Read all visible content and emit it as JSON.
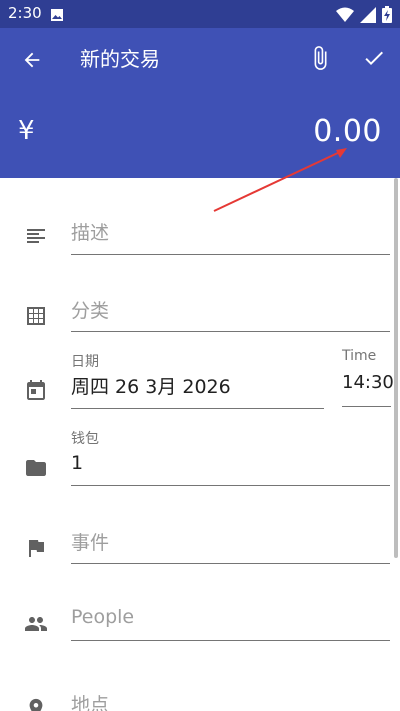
{
  "status_bar": {
    "time": "2:30"
  },
  "app_bar": {
    "title": "新的交易",
    "currency_symbol": "¥",
    "amount": "0.00",
    "color": "#3f51b5"
  },
  "form": {
    "description": {
      "placeholder": "描述"
    },
    "category": {
      "placeholder": "分类"
    },
    "date": {
      "label": "日期",
      "value": "周四 26 3月 2026"
    },
    "time": {
      "label": "Time",
      "value": "14:30"
    },
    "wallet": {
      "label": "钱包",
      "value": "1"
    },
    "event": {
      "placeholder": "事件"
    },
    "people": {
      "placeholder": "People"
    },
    "place": {
      "placeholder": "地点"
    }
  }
}
